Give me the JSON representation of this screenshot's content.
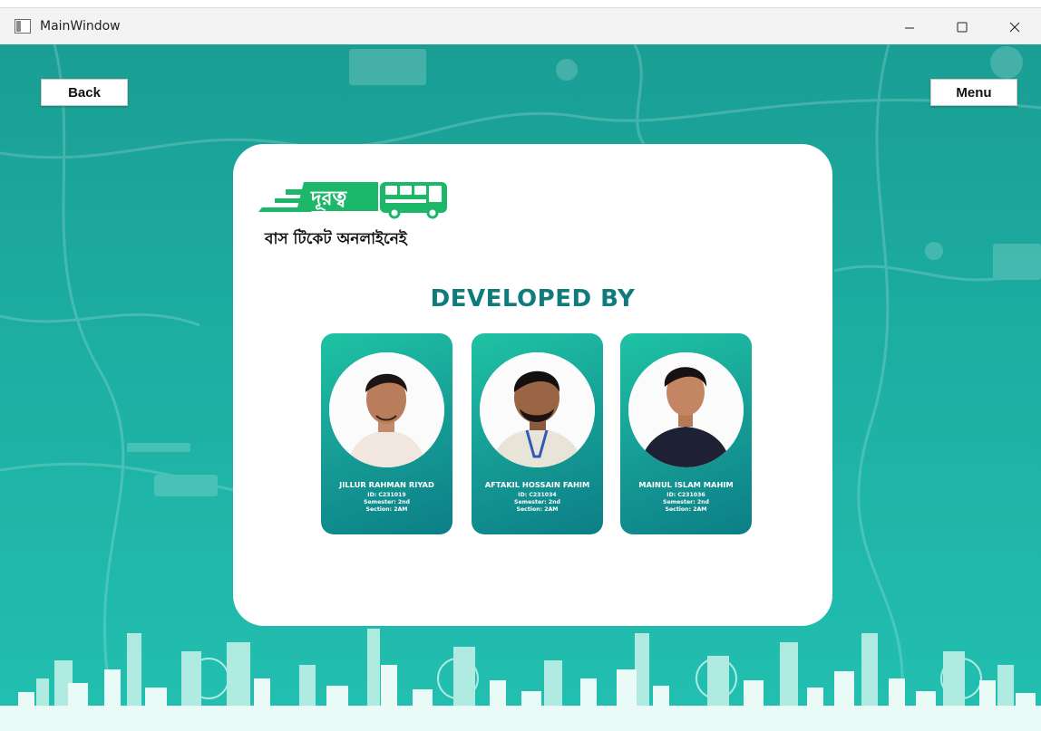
{
  "window": {
    "title": "MainWindow",
    "controls": [
      "minimize-icon",
      "maximize-icon",
      "close-icon"
    ]
  },
  "nav": {
    "back_label": "Back",
    "menu_label": "Menu"
  },
  "logo": {
    "brand_text": "দূরত্ব",
    "tagline": "বাস টিকেট অনলাইনেই"
  },
  "section_title": "DEVELOPED BY",
  "developers": [
    {
      "name": "JILLUR RAHMAN RIYAD",
      "id": "ID: C231019",
      "semester": "Semester: 2nd",
      "section": "Section: 2AM"
    },
    {
      "name": "AFTAKIL HOSSAIN FAHIM",
      "id": "ID: C231034",
      "semester": "Semester: 2nd",
      "section": "Section: 2AM"
    },
    {
      "name": "MAINUL ISLAM MAHIM",
      "id": "ID: C231036",
      "semester": "Semester: 2nd",
      "section": "Section: 2AM"
    }
  ],
  "colors": {
    "teal_bg": "#1daea2",
    "title_teal": "#0e7c7b",
    "logo_green": "#1db76a"
  }
}
